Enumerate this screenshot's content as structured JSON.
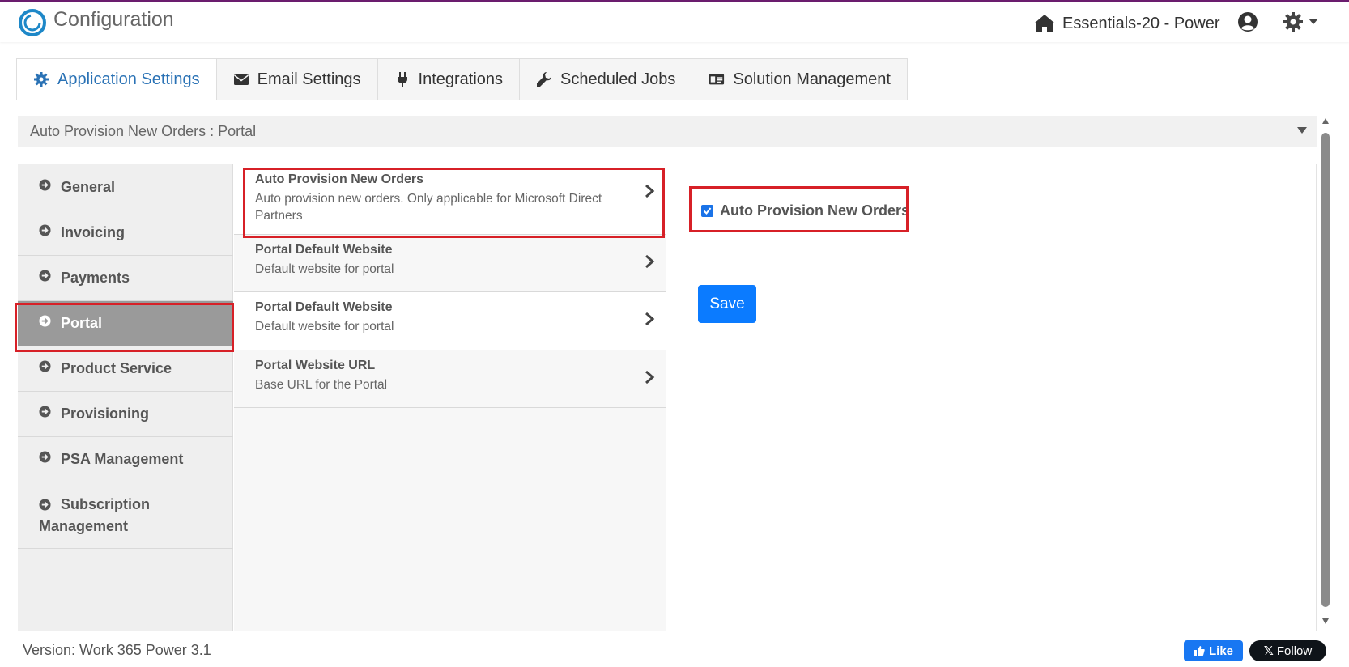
{
  "app": {
    "title": "Configuration",
    "tenant": "Essentials-20 - Power",
    "version": "Version: Work 365 Power 3.1"
  },
  "tabs": [
    {
      "label": "Application Settings",
      "icon": "gear-icon",
      "active": true
    },
    {
      "label": "Email Settings",
      "icon": "envelope-icon",
      "active": false
    },
    {
      "label": "Integrations",
      "icon": "plug-icon",
      "active": false
    },
    {
      "label": "Scheduled Jobs",
      "icon": "wrench-icon",
      "active": false
    },
    {
      "label": "Solution Management",
      "icon": "id-card-icon",
      "active": false
    }
  ],
  "breadcrumb": {
    "value": "Auto Provision New Orders : Portal"
  },
  "categories": [
    {
      "label": "General"
    },
    {
      "label": "Invoicing"
    },
    {
      "label": "Payments"
    },
    {
      "label": "Portal",
      "active": true
    },
    {
      "label": "Product Service"
    },
    {
      "label": "Provisioning"
    },
    {
      "label": "PSA Management"
    },
    {
      "label": "Subscription Management"
    }
  ],
  "settings": [
    {
      "title": "Auto Provision New Orders",
      "desc": "Auto provision new orders. Only applicable for Microsoft Direct Partners",
      "selected": true
    },
    {
      "title": "Portal Default Website",
      "desc": "Default website for portal"
    },
    {
      "title": "Portal Default Website",
      "desc": "Default website for portal"
    },
    {
      "title": "Portal Website URL",
      "desc": "Base URL for the Portal"
    }
  ],
  "detail": {
    "checkbox_label": "Auto Provision New Orders",
    "checked": true,
    "save_label": "Save"
  },
  "social": {
    "like_label": "Like",
    "follow_label": "Follow"
  },
  "colors": {
    "accent": "#2a72b5",
    "highlight": "#d72027",
    "primary_button": "#0b7bff",
    "brand_top": "#6b1d6e"
  }
}
